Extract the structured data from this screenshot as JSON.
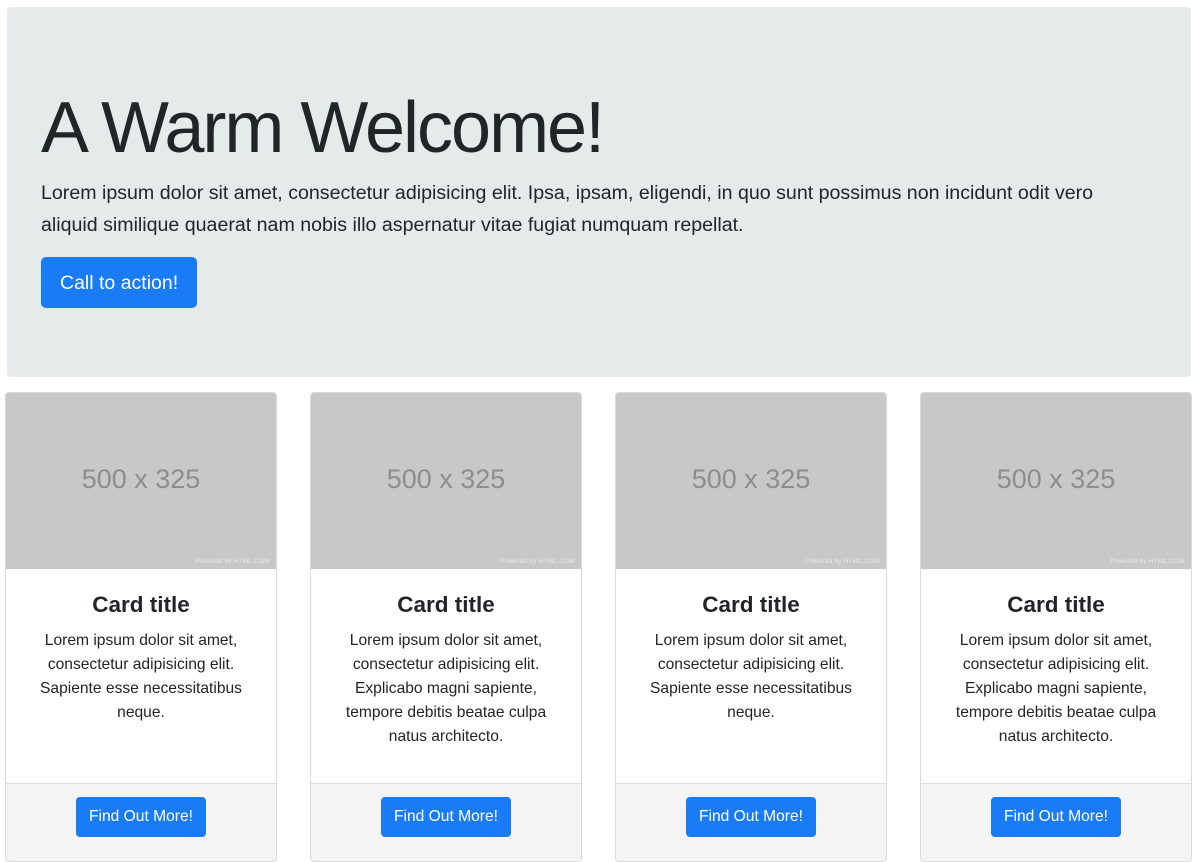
{
  "hero": {
    "title": "A Warm Welcome!",
    "text": "Lorem ipsum dolor sit amet, consectetur adipisicing elit. Ipsa, ipsam, eligendi, in quo sunt possimus non incidunt odit vero aliquid similique quaerat nam nobis illo aspernatur vitae fugiat numquam repellat.",
    "cta_label": "Call to action!"
  },
  "colors": {
    "accent": "#1a7bf7",
    "jumbotron_bg": "#e5eaea",
    "placeholder_bg": "#c8c8c8"
  },
  "cards": [
    {
      "image_label": "500 x 325",
      "image_credit": "Powered by HTML.COM",
      "title": "Card title",
      "text": "Lorem ipsum dolor sit amet, consectetur adipisicing elit. Sapiente esse necessitatibus neque.",
      "button_label": "Find Out More!"
    },
    {
      "image_label": "500 x 325",
      "image_credit": "Powered by HTML.COM",
      "title": "Card title",
      "text": "Lorem ipsum dolor sit amet, consectetur adipisicing elit. Explicabo magni sapiente, tempore debitis beatae culpa natus architecto.",
      "button_label": "Find Out More!"
    },
    {
      "image_label": "500 x 325",
      "image_credit": "Powered by HTML.COM",
      "title": "Card title",
      "text": "Lorem ipsum dolor sit amet, consectetur adipisicing elit. Sapiente esse necessitatibus neque.",
      "button_label": "Find Out More!"
    },
    {
      "image_label": "500 x 325",
      "image_credit": "Powered by HTML.COM",
      "title": "Card title",
      "text": "Lorem ipsum dolor sit amet, consectetur adipisicing elit. Explicabo magni sapiente, tempore debitis beatae culpa natus architecto.",
      "button_label": "Find Out More!"
    }
  ]
}
